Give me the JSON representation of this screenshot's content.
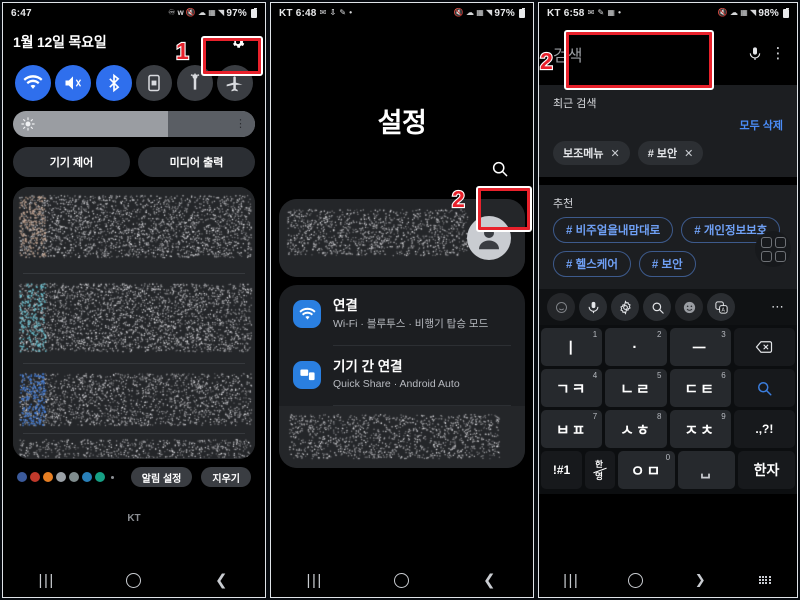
{
  "meta": {
    "accent_red": "#e8212b",
    "accent_blue": "#2f6fed",
    "link_blue": "#4a8cf7"
  },
  "panel1": {
    "status": {
      "time": "6:47",
      "battery": "97%",
      "icons": [
        "headset-icon",
        "bluetooth-icon",
        "mute-icon",
        "wifi-calling-icon",
        "sim-icon",
        "signal-icon"
      ]
    },
    "date": "1월 12일 목요일",
    "gear_icon": "gear-icon",
    "toggles": [
      {
        "name": "wifi-toggle",
        "icon": "wifi-icon",
        "state": "on"
      },
      {
        "name": "sound-toggle",
        "icon": "mute-vibrate-icon",
        "state": "on"
      },
      {
        "name": "bluetooth-toggle",
        "icon": "bluetooth-icon",
        "state": "on"
      },
      {
        "name": "autorotate-toggle",
        "icon": "rotate-lock-icon",
        "state": "off"
      },
      {
        "name": "flashlight-toggle",
        "icon": "flashlight-icon",
        "state": "off"
      },
      {
        "name": "airplane-toggle",
        "icon": "airplane-icon",
        "state": "off"
      }
    ],
    "brightness": {
      "icon": "brightness-icon",
      "value_pct": 64,
      "menu_icon": "more-vertical-icon"
    },
    "buttons": {
      "device_control": "기기 제어",
      "media_output": "미디어 출력"
    },
    "notifications_footer": {
      "settings": "알림 설정",
      "clear": "지우기"
    },
    "carrier": "KT",
    "nav": {
      "recent": "recent-apps-icon",
      "home": "home-icon",
      "back": "back-icon"
    }
  },
  "panel2": {
    "status": {
      "carrier": "KT",
      "time": "6:48",
      "battery": "97%"
    },
    "title": "설정",
    "search_icon": "search-icon",
    "profile": {
      "avatar_icon": "person-avatar-icon"
    },
    "rows": [
      {
        "title": "연결",
        "subtitle": "Wi-Fi  ·  블루투스  ·  비행기 탑승 모드",
        "icon": "wifi-icon"
      },
      {
        "title": "기기 간 연결",
        "subtitle": "Quick Share  ·  Android Auto",
        "icon": "device-connect-icon"
      }
    ],
    "nav": {
      "recent": "recent-apps-icon",
      "home": "home-icon",
      "back": "back-icon"
    }
  },
  "panel3": {
    "status": {
      "carrier": "KT",
      "time": "6:58",
      "battery": "98%"
    },
    "search": {
      "placeholder": "검색",
      "mic_icon": "microphone-icon",
      "menu_icon": "more-vertical-icon"
    },
    "recent": {
      "heading": "최근 검색",
      "clear_all": "모두 삭제",
      "chips": [
        {
          "label": "보조메뉴",
          "remove_icon": "close-icon"
        },
        {
          "label": "# 보안",
          "remove_icon": "close-icon"
        }
      ]
    },
    "suggested": {
      "heading": "추천",
      "chips": [
        "# 비주얼을내맘대로",
        "# 개인정보보호",
        "# 헬스케어",
        "# 보안"
      ],
      "grid_fab_icon": "app-grid-icon"
    },
    "keyboard_toolbar": [
      "sticker-icon",
      "microphone-icon",
      "settings-gear-icon",
      "search-icon",
      "emoji-icon",
      "translate-icon",
      "more-horizontal-icon"
    ],
    "keyboard": {
      "rows": [
        [
          {
            "label": "ㅣ",
            "num": "1"
          },
          {
            "label": "·",
            "num": "2"
          },
          {
            "label": "ㅡ",
            "num": "3"
          },
          {
            "label": "",
            "num": "",
            "icon": "backspace-icon",
            "dark": true
          }
        ],
        [
          {
            "label": "ㄱㅋ",
            "num": "4"
          },
          {
            "label": "ㄴㄹ",
            "num": "5"
          },
          {
            "label": "ㄷㅌ",
            "num": "6"
          },
          {
            "label": "",
            "num": "",
            "icon": "search-icon",
            "dark": true
          }
        ],
        [
          {
            "label": "ㅂㅍ",
            "num": "7"
          },
          {
            "label": "ㅅㅎ",
            "num": "8"
          },
          {
            "label": "ㅈㅊ",
            "num": "9"
          },
          {
            "label": ".,?!",
            "num": "",
            "dark": true
          }
        ],
        [
          {
            "label": "!#1",
            "num": "",
            "dark": true
          },
          {
            "label": "한/영",
            "num": "",
            "dark": true
          },
          {
            "label": "ㅇㅁ",
            "num": "0"
          },
          {
            "label": "space",
            "num": ""
          },
          {
            "label": "한자",
            "num": "",
            "dark": true
          }
        ]
      ]
    },
    "nav": {
      "recent": "recent-apps-icon",
      "home": "home-icon",
      "collapse": "chevron-down-icon",
      "keyboard": "keyboard-icon"
    }
  },
  "annotations": [
    {
      "number": "1",
      "target": "quick-panel-settings-gear"
    },
    {
      "number": "2",
      "target": "settings-search-icon"
    },
    {
      "number": "2",
      "target": "search-input-field"
    }
  ]
}
